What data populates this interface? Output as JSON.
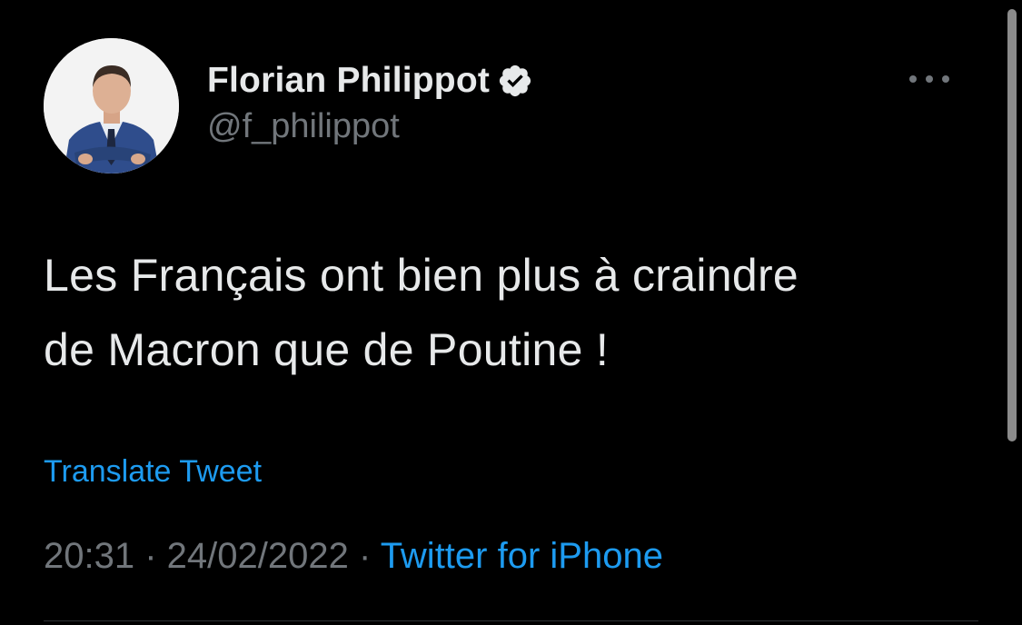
{
  "tweet": {
    "author": {
      "display_name": "Florian Philippot",
      "handle": "@f_philippot",
      "verified_icon": "verified-badge-icon",
      "avatar_icon": "avatar-photo"
    },
    "more_icon": "more-horizontal-icon",
    "text_lines": [
      "Les Français ont bien plus à craindre",
      "de Macron que de Poutine !"
    ],
    "translate_label": "Translate Tweet",
    "time": "20:31",
    "separator": " · ",
    "date": "24/02/2022",
    "source": "Twitter for iPhone"
  },
  "colors": {
    "background": "#000000",
    "text_primary": "#e7e9ea",
    "text_secondary": "#71767b",
    "link": "#1d9bf0"
  }
}
